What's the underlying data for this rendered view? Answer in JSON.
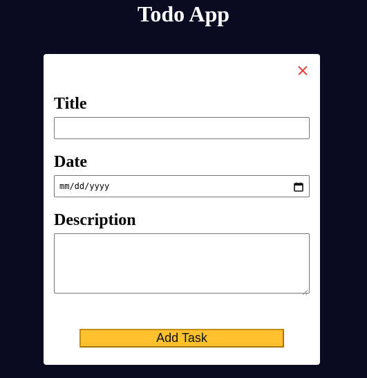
{
  "app": {
    "title": "Todo App"
  },
  "modal": {
    "close_icon": "close-icon",
    "fields": {
      "title": {
        "label": "Title",
        "value": ""
      },
      "date": {
        "label": "Date",
        "placeholder": "mm/dd/yyyy",
        "icon": "calendar-icon"
      },
      "description": {
        "label": "Description",
        "value": ""
      }
    },
    "submit_label": "Add Task"
  },
  "colors": {
    "page_background": "#0a0a22",
    "modal_background": "#ffffff",
    "close_icon": "#e0463c",
    "button_background": "#ffc12e",
    "button_border": "#c98a12"
  }
}
